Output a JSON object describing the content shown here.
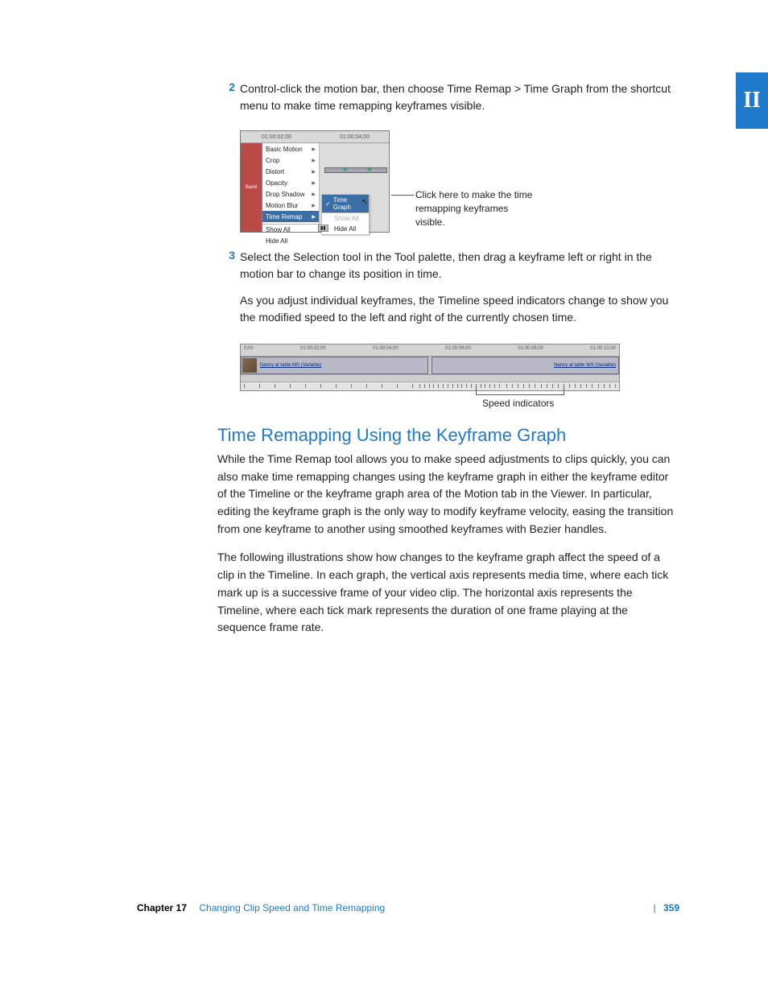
{
  "sideTab": "II",
  "step2": {
    "num": "2",
    "text": "Control-click the motion bar, then choose Time Remap > Time Graph from the shortcut menu to make time remapping keyframes visible."
  },
  "figure1": {
    "time1": "01:00:02;00",
    "time2": "01:00:04;00",
    "leftLabel": "Band",
    "menu": {
      "basic": "Basic Motion",
      "crop": "Crop",
      "distort": "Distort",
      "opacity": "Opacity",
      "drop": "Drop Shadow",
      "blur": "Motion Blur",
      "remap": "Time Remap",
      "showAll": "Show All",
      "hideAll": "Hide All"
    },
    "submenu": {
      "timeGraph": "Time Graph",
      "showAll": "Show All",
      "hideAll": "Hide All"
    }
  },
  "callout1": "Click here to make the time remapping keyframes visible.",
  "step3": {
    "num": "3",
    "text": "Select the Selection tool in the Tool palette, then drag a keyframe left or right in the motion bar to change its position in time.",
    "cont": "As you adjust individual keyframes, the Timeline speed indicators change to show you the modified speed to the left and right of the currently chosen time."
  },
  "figure2": {
    "ruler": {
      "t0": "0;00",
      "t1": "01:00:02;00",
      "t2": "01:00:04;00",
      "t3": "01:00:06;00",
      "t4": "01:00:08;00",
      "t5": "01:00:10;00"
    },
    "clipLeft": "Nancy at table MS (Variable)",
    "clipRight": "Nancy at table WS (Variable)"
  },
  "callout2": "Speed indicators",
  "sectionTitle": "Time Remapping Using the Keyframe Graph",
  "para1": "While the Time Remap tool allows you to make speed adjustments to clips quickly, you can also make time remapping changes using the keyframe graph in either the keyframe editor of the Timeline or the keyframe graph area of the Motion tab in the Viewer. In particular, editing the keyframe graph is the only way to modify keyframe velocity, easing the transition from one keyframe to another using smoothed keyframes with Bezier handles.",
  "para2": "The following illustrations show how changes to the keyframe graph affect the speed of a clip in the Timeline. In each graph, the vertical axis represents media time, where each tick mark up is a successive frame of your video clip. The horizontal axis represents the Timeline, where each tick mark represents the duration of one frame playing at the sequence frame rate.",
  "footer": {
    "chapterLabel": "Chapter 17",
    "chapterTitle": "Changing Clip Speed and Time Remapping",
    "pageNum": "359"
  }
}
